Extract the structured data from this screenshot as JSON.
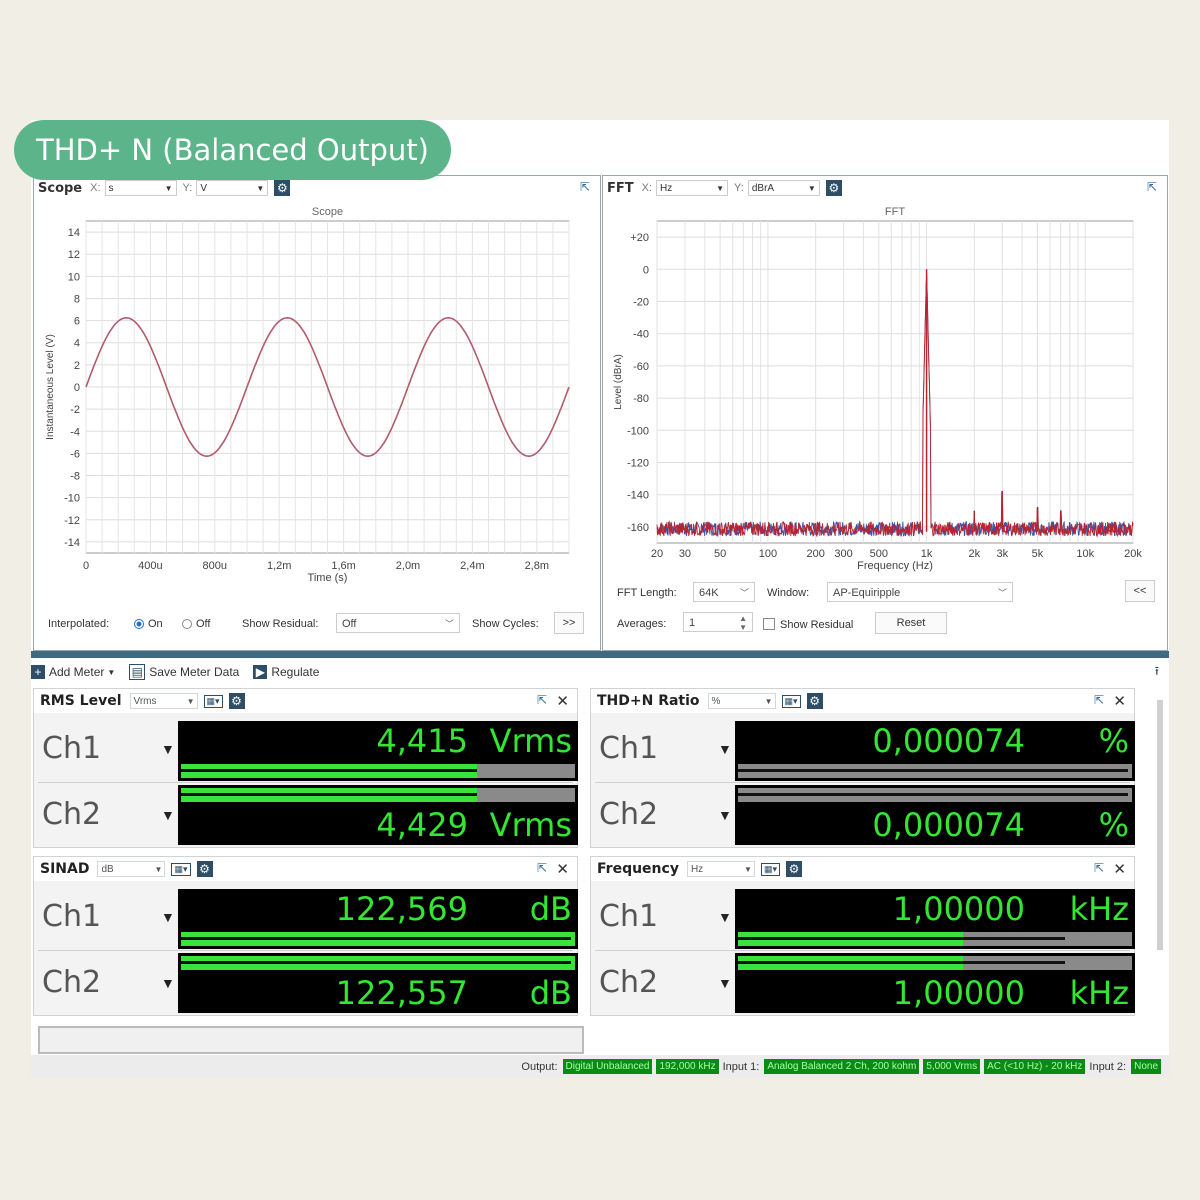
{
  "badge": "THD+ N (Balanced Output)",
  "scope": {
    "title": "Scope",
    "x_label": "X:",
    "x_unit": "s",
    "y_label": "Y:",
    "y_unit": "V",
    "chart_title": "Scope",
    "xlabel": "Time (s)",
    "ylabel": "Instantaneous Level (V)",
    "interpolated_label": "Interpolated:",
    "on_label": "On",
    "off_label": "Off",
    "show_residual_label": "Show Residual:",
    "show_residual_value": "Off",
    "show_cycles_label": "Show Cycles:",
    "show_cycles_button": ">>"
  },
  "fft": {
    "title": "FFT",
    "x_label": "X:",
    "x_unit": "Hz",
    "y_label": "Y:",
    "y_unit": "dBrA",
    "chart_title": "FFT",
    "xlabel": "Frequency (Hz)",
    "ylabel": "Level (dBrA)",
    "length_label": "FFT Length:",
    "length_value": "64K",
    "window_label": "Window:",
    "window_value": "AP-Equiripple",
    "collapse_button": "<<",
    "averages_label": "Averages:",
    "averages_value": "1",
    "show_residual_label": "Show Residual",
    "reset_button": "Reset"
  },
  "toolbar": {
    "add_meter": "Add Meter",
    "save_meter_data": "Save Meter Data",
    "regulate": "Regulate"
  },
  "meters": [
    {
      "title": "RMS Level",
      "unit_select": "Vrms",
      "ch1_label": "Ch1",
      "ch2_label": "Ch2",
      "ch1_value": "4,415",
      "ch2_value": "4,429",
      "unit": "Vrms",
      "ch1_bar": 0.75,
      "ch2_bar": 0.75,
      "ch1_peak": 0.75,
      "ch2_peak": 0.75
    },
    {
      "title": "THD+N Ratio",
      "unit_select": "%",
      "ch1_label": "Ch1",
      "ch2_label": "Ch2",
      "ch1_value": "0,000074",
      "ch2_value": "0,000074",
      "unit": "%",
      "ch1_bar": 0.0,
      "ch2_bar": 0.0,
      "ch1_peak": 0.99,
      "ch2_peak": 0.99
    },
    {
      "title": "SINAD",
      "unit_select": "dB",
      "ch1_label": "Ch1",
      "ch2_label": "Ch2",
      "ch1_value": "122,569",
      "ch2_value": "122,557",
      "unit": "dB",
      "ch1_bar": 1.0,
      "ch2_bar": 1.0,
      "ch1_peak": 0.99,
      "ch2_peak": 0.99
    },
    {
      "title": "Frequency",
      "unit_select": "Hz",
      "ch1_label": "Ch1",
      "ch2_label": "Ch2",
      "ch1_value": "1,00000",
      "ch2_value": "1,00000",
      "unit": "kHz",
      "ch1_bar": 0.57,
      "ch2_bar": 0.57,
      "ch1_peak": 0.83,
      "ch2_peak": 0.83
    }
  ],
  "status": {
    "output_label": "Output:",
    "output_value": "Digital Unbalanced",
    "output_rate": "192,000 kHz",
    "input1_label": "Input 1:",
    "input1_value": "Analog Balanced 2 Ch, 200 kohm",
    "input1_range": "5,000 Vrms",
    "input1_bw": "AC (<10 Hz) - 20 kHz",
    "input2_label": "Input 2:",
    "input2_value": "None"
  },
  "colors": {
    "accent": "#5cb58a",
    "meter_text": "#32e632",
    "scope_trace": "#b25b6a",
    "fft_ch1": "#b8232e",
    "fft_ch2": "#3b55a8"
  },
  "chart_data": [
    {
      "type": "line",
      "title": "Scope",
      "xlabel": "Time (s)",
      "ylabel": "Instantaneous Level (V)",
      "xlim": [
        0,
        0.003
      ],
      "ylim": [
        -15,
        15
      ],
      "x_tick_labels": [
        "0",
        "400u",
        "800u",
        "1,2m",
        "1,6m",
        "2,0m",
        "2,4m",
        "2,8m"
      ],
      "x_tick_values": [
        0,
        0.0004,
        0.0008,
        0.0012,
        0.0016,
        0.002,
        0.0024,
        0.0028
      ],
      "y_ticks": [
        14,
        12,
        10,
        8,
        6,
        4,
        2,
        0,
        -2,
        -4,
        -6,
        -8,
        -10,
        -12,
        -14
      ],
      "series": [
        {
          "frequency_hz": 1000,
          "amplitude_v": 6.25,
          "phase_deg": 0
        }
      ],
      "grid": true
    },
    {
      "type": "line",
      "title": "FFT",
      "xlabel": "Frequency (Hz)",
      "ylabel": "Level (dBrA)",
      "x_scale": "log",
      "xlim": [
        20,
        20000
      ],
      "ylim": [
        -170,
        30
      ],
      "x_tick_labels": [
        "20",
        "30",
        "50",
        "100",
        "200",
        "300",
        "500",
        "1k",
        "2k",
        "3k",
        "5k",
        "10k",
        "20k"
      ],
      "x_tick_values": [
        20,
        30,
        50,
        100,
        200,
        300,
        500,
        1000,
        2000,
        3000,
        5000,
        10000,
        20000
      ],
      "y_tick_labels": [
        "+20",
        "0",
        "-20",
        "-40",
        "-60",
        "-80",
        "-100",
        "-120",
        "-140",
        "-160"
      ],
      "y_tick_values": [
        20,
        0,
        -20,
        -40,
        -60,
        -80,
        -100,
        -120,
        -140,
        -160
      ],
      "fundamental": {
        "x": 1000,
        "y": 0
      },
      "harmonics": [
        {
          "x": 2000,
          "y": -150
        },
        {
          "x": 3000,
          "y": -138
        },
        {
          "x": 5000,
          "y": -148
        },
        {
          "x": 7000,
          "y": -150
        }
      ],
      "noise_floor": -163,
      "grid": true
    }
  ]
}
